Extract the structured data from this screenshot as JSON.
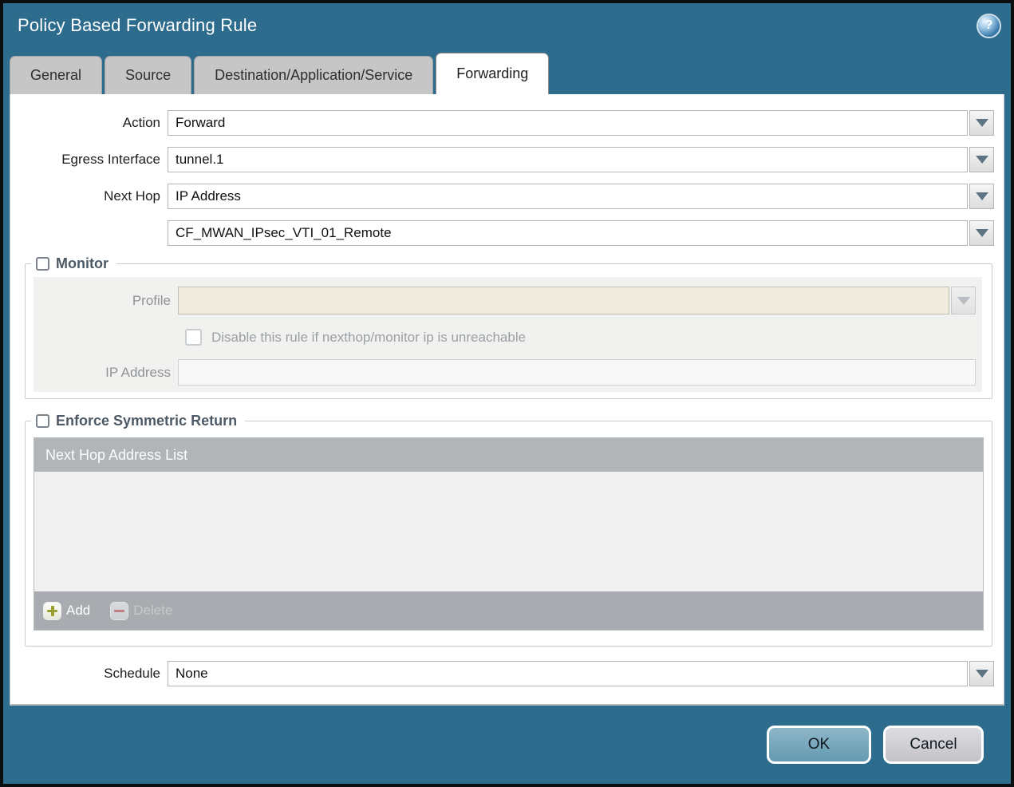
{
  "dialog": {
    "title": "Policy Based Forwarding Rule"
  },
  "icons": {
    "help": "?"
  },
  "tabs": [
    {
      "label": "General",
      "active": false
    },
    {
      "label": "Source",
      "active": false
    },
    {
      "label": "Destination/Application/Service",
      "active": false
    },
    {
      "label": "Forwarding",
      "active": true
    }
  ],
  "form": {
    "action": {
      "label": "Action",
      "value": "Forward"
    },
    "egress_interface": {
      "label": "Egress Interface",
      "value": "tunnel.1"
    },
    "next_hop": {
      "label": "Next Hop",
      "type_value": "IP Address",
      "address_value": "CF_MWAN_IPsec_VTI_01_Remote"
    },
    "schedule": {
      "label": "Schedule",
      "value": "None"
    }
  },
  "monitor": {
    "label": "Monitor",
    "checked": false,
    "profile": {
      "label": "Profile",
      "value": ""
    },
    "disable_rule": {
      "label": "Disable this rule if nexthop/monitor ip is unreachable",
      "checked": false
    },
    "ip_address": {
      "label": "IP Address",
      "value": ""
    }
  },
  "enforce_symmetric_return": {
    "label": "Enforce Symmetric Return",
    "checked": false,
    "table": {
      "header": "Next Hop Address List",
      "rows": []
    },
    "add_label": "Add",
    "delete_label": "Delete"
  },
  "footer": {
    "ok_label": "OK",
    "cancel_label": "Cancel"
  },
  "colors": {
    "header_teal": "#2e6c8e",
    "ok_button": "#6fa3b9",
    "cancel_button": "#c9c9cd",
    "disabled_profile_field": "#f0ebdc",
    "table_header": "#b1b5b8",
    "add_plus": "#97a02f",
    "delete_minus": "#c4767c"
  }
}
